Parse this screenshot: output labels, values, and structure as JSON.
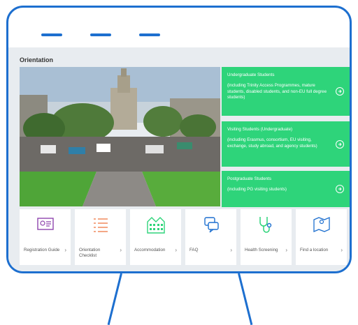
{
  "page": {
    "title": "Orientation"
  },
  "panels": [
    {
      "title": "Undergraduate Students",
      "desc": "(including Trinity Access Programmes, mature students, disabled students, and non-EU full degree students)"
    },
    {
      "title": "Visiting Students (Undergraduate)",
      "desc": "(including Erasmus, consortium, EU visiting, exchange, study abroad, and agency students)"
    },
    {
      "title": "Postgraduate Students",
      "desc": "(including PG visiting students)"
    }
  ],
  "tiles": [
    {
      "label": "Registration Guide",
      "icon": "id-card-icon",
      "color": "#8e44ad"
    },
    {
      "label": "Orientation Checklist",
      "icon": "checklist-icon",
      "color": "#f08a5d"
    },
    {
      "label": "Accommodation",
      "icon": "building-icon",
      "color": "#2ed47a"
    },
    {
      "label": "FAQ",
      "icon": "chat-icon",
      "color": "#1d6fcf"
    },
    {
      "label": "Health Screening",
      "icon": "stethoscope-icon",
      "color": "#2ed47a"
    },
    {
      "label": "Find a location",
      "icon": "map-icon",
      "color": "#1d6fcf"
    }
  ],
  "colors": {
    "frame": "#1d6fcf",
    "accent_green": "#2ed47a",
    "background": "#e8ecf0"
  }
}
